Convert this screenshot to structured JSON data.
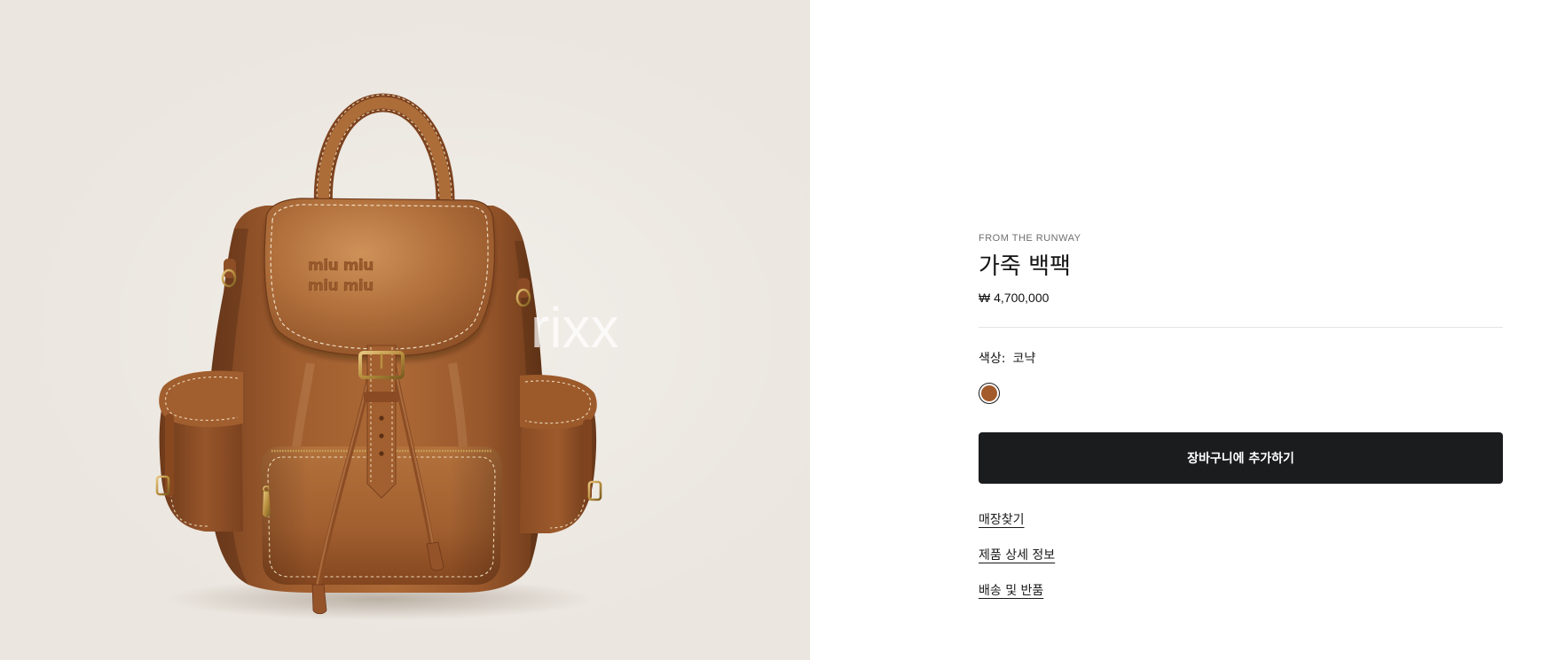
{
  "product_image": {
    "background": "#ebe6df",
    "embossed_logo": "miu miu",
    "watermark": "rixx"
  },
  "product": {
    "collection": "FROM THE RUNWAY",
    "name": "가죽 백팩",
    "price": "₩ 4,700,000"
  },
  "color_selector": {
    "label": "색상:",
    "selected_value": "코냑",
    "swatches": [
      {
        "color": "#a35b2b",
        "selected": true
      }
    ]
  },
  "add_to_cart": {
    "label": "장바구니에 추가하기",
    "background": "#1b1c1e",
    "text_color": "#ffffff"
  },
  "links": [
    {
      "label": "매장찾기"
    },
    {
      "label": "제품 상세 정보"
    },
    {
      "label": "배송 및 반품"
    }
  ]
}
